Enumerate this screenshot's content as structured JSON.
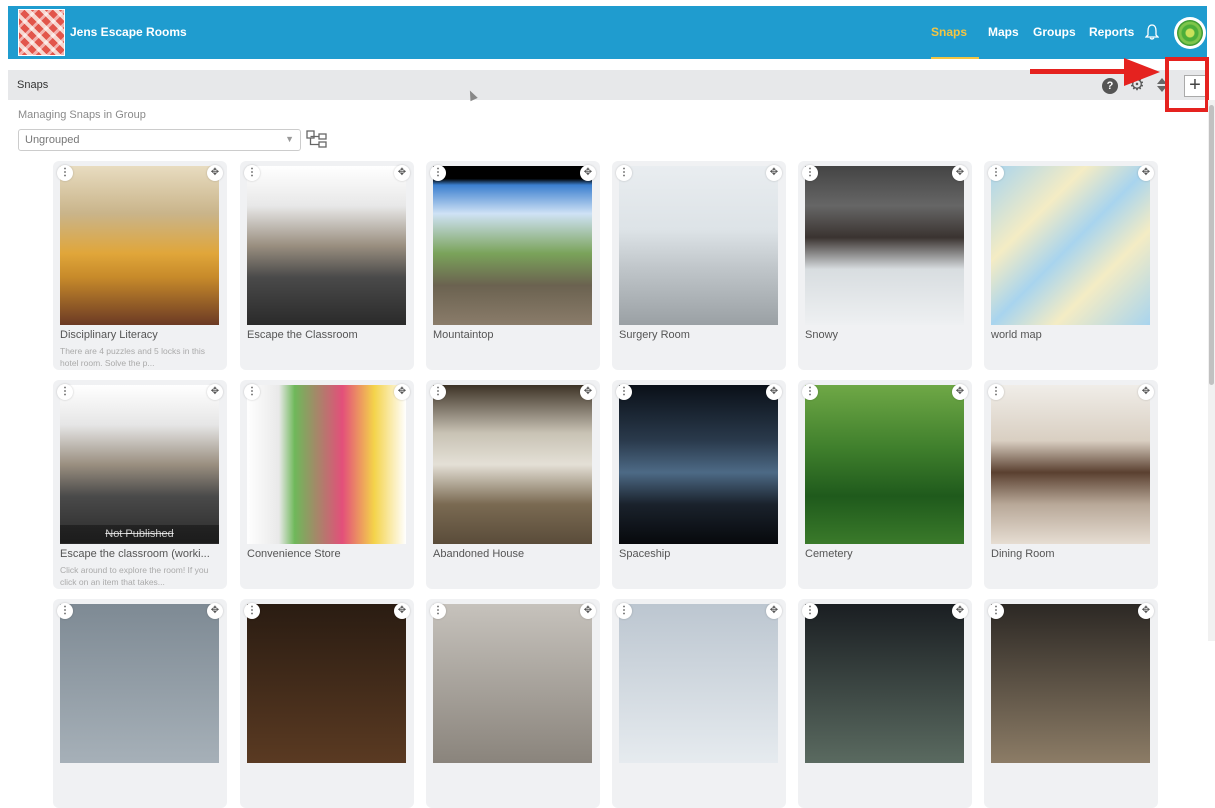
{
  "header": {
    "app_title": "Jens Escape Rooms",
    "nav": [
      "Snaps",
      "Maps",
      "Groups",
      "Reports"
    ],
    "active_nav": "Snaps",
    "accent_color": "#f4c542",
    "bar_color": "#1f9ccf"
  },
  "subheader": {
    "title": "Snaps"
  },
  "toolbar": {
    "help_label": "?",
    "gear_label": "⚙",
    "add_label": "+"
  },
  "group": {
    "label": "Managing Snaps in Group",
    "selected": "Ungrouped"
  },
  "cards": [
    {
      "title": "Disciplinary Literacy",
      "desc": "There are 4 puzzles and 5 locks in this hotel room. Solve the p...",
      "published": true
    },
    {
      "title": "Escape the Classroom",
      "desc": "",
      "published": true
    },
    {
      "title": "Mountaintop",
      "desc": "",
      "published": true
    },
    {
      "title": "Surgery Room",
      "desc": "",
      "published": true
    },
    {
      "title": "Snowy",
      "desc": "",
      "published": true
    },
    {
      "title": "world map",
      "desc": "",
      "published": true
    },
    {
      "title": "Escape the classroom (worki...",
      "desc": "Click around to explore the room! If you click on an item that takes...",
      "published": false,
      "badge": "Not Published"
    },
    {
      "title": "Convenience Store",
      "desc": "",
      "published": true
    },
    {
      "title": "Abandoned House",
      "desc": "",
      "published": true
    },
    {
      "title": "Spaceship",
      "desc": "",
      "published": true
    },
    {
      "title": "Cemetery",
      "desc": "",
      "published": true
    },
    {
      "title": "Dining Room",
      "desc": "",
      "published": true
    },
    {
      "title": "",
      "desc": "",
      "published": true
    },
    {
      "title": "",
      "desc": "",
      "published": true
    },
    {
      "title": "",
      "desc": "",
      "published": true
    },
    {
      "title": "",
      "desc": "",
      "published": true
    },
    {
      "title": "",
      "desc": "",
      "published": true
    },
    {
      "title": "",
      "desc": "",
      "published": true
    }
  ],
  "icons": {
    "menu": "kebab-menu-icon",
    "move": "move-icon"
  }
}
